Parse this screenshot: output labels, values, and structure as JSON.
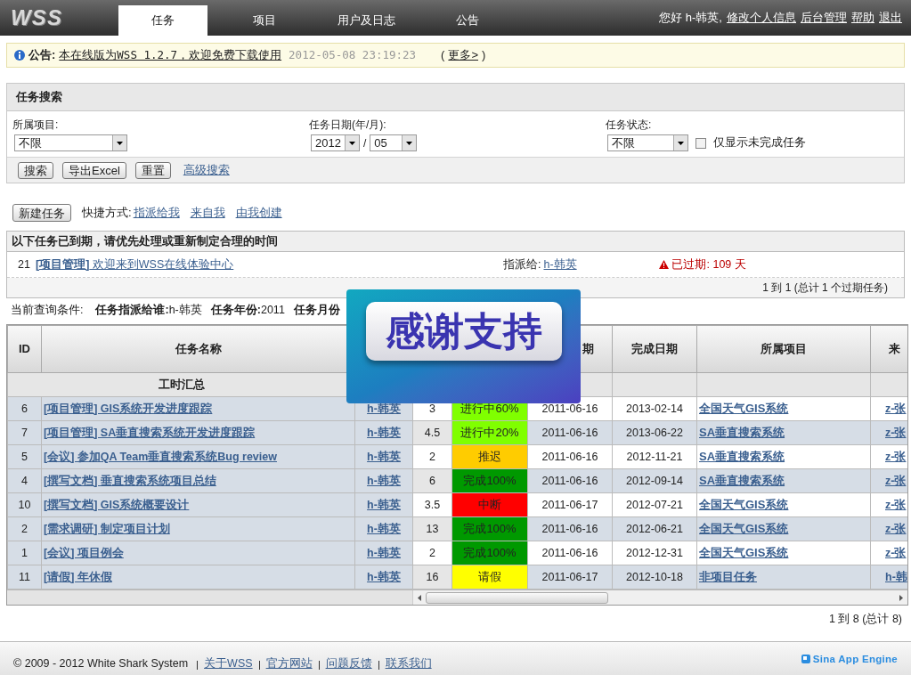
{
  "header": {
    "logo": "WSS",
    "tabs": [
      {
        "label": "任务",
        "selected": true
      },
      {
        "label": "项目",
        "selected": false
      },
      {
        "label": "用户及日志",
        "selected": false
      },
      {
        "label": "公告",
        "selected": false
      }
    ],
    "greeting": "您好 h-韩英,",
    "links": [
      "修改个人信息",
      "后台管理",
      "帮助",
      "退出"
    ]
  },
  "notice": {
    "label": "公告:",
    "text": "本在线版为WSS 1.2.7，欢迎免费下载使用",
    "time": "2012-05-08 23:19:23",
    "more_open": "(",
    "more": "更多>",
    "more_close": ")"
  },
  "search": {
    "title": "任务搜索",
    "project_label": "所属项目:",
    "project_value": "不限",
    "date_label": "任务日期(年/月):",
    "year": "2012",
    "sep": "/",
    "month": "05",
    "status_label": "任务状态:",
    "status_value": "不限",
    "only_unfinished": {
      "label": "仅显示未完成任务",
      "checked": false
    },
    "buttons": [
      "搜索",
      "导出Excel",
      "重置"
    ],
    "advanced": "高级搜索"
  },
  "actions": {
    "new_task": "新建任务",
    "shortcut_label": "快捷方式:",
    "shortcuts": [
      "指派给我",
      "来自我",
      "由我创建"
    ]
  },
  "overdue": {
    "title": "以下任务已到期，请优先处理或重新制定合理的时间",
    "rows": [
      {
        "id": "21",
        "category": "[项目管理]",
        "name": "欢迎来到WSS在线体验中心",
        "assign_label": "指派给:",
        "assignee": "h-韩英",
        "overdue": "已过期: 109 天"
      }
    ],
    "pager": "1 到 1 (总计 1 个过期任务)"
  },
  "query": {
    "label": "当前查询条件:",
    "conditions": [
      {
        "key": "任务指派给谁:",
        "value": "h-韩英"
      },
      {
        "key": "任务年份:",
        "value": "2011"
      },
      {
        "key": "任务月份"
      }
    ]
  },
  "table": {
    "columns": [
      "ID",
      "任务名称",
      "",
      "",
      "",
      "期",
      "完成日期",
      "所属项目",
      "来"
    ],
    "summary_label": "工时汇总",
    "rows": [
      {
        "id": "6",
        "name": "[项目管理] GIS系统开发进度跟踪",
        "owner": "h-韩英",
        "hours": "3",
        "status": "进行中60%",
        "color": "#80ff00",
        "start": "2011-06-16",
        "end": "2013-02-14",
        "project": "全国天气GIS系统",
        "from": "z-张"
      },
      {
        "id": "7",
        "name": "[项目管理] SA垂直搜索系统开发进度跟踪",
        "owner": "h-韩英",
        "hours": "4.5",
        "status": "进行中20%",
        "color": "#80ff00",
        "start": "2011-06-16",
        "end": "2013-06-22",
        "project": "SA垂直搜索系统",
        "from": "z-张"
      },
      {
        "id": "5",
        "name": "[会议] 参加QA Team垂直搜索系统Bug review",
        "owner": "h-韩英",
        "hours": "2",
        "status": "推迟",
        "color": "#ffcc00",
        "start": "2011-06-16",
        "end": "2012-11-21",
        "project": "SA垂直搜索系统",
        "from": "z-张"
      },
      {
        "id": "4",
        "name": "[撰写文档] 垂直搜索系统项目总结",
        "owner": "h-韩英",
        "hours": "6",
        "status": "完成100%",
        "color": "#009900",
        "start": "2011-06-16",
        "end": "2012-09-14",
        "project": "SA垂直搜索系统",
        "from": "z-张"
      },
      {
        "id": "10",
        "name": "[撰写文档] GIS系统概要设计",
        "owner": "h-韩英",
        "hours": "3.5",
        "status": "中断",
        "color": "#ff0000",
        "start": "2011-06-17",
        "end": "2012-07-21",
        "project": "全国天气GIS系统",
        "from": "z-张"
      },
      {
        "id": "2",
        "name": "[需求调研] 制定项目计划",
        "owner": "h-韩英",
        "hours": "13",
        "status": "完成100%",
        "color": "#009900",
        "start": "2011-06-16",
        "end": "2012-06-21",
        "project": "全国天气GIS系统",
        "from": "z-张"
      },
      {
        "id": "1",
        "name": "[会议] 项目例会",
        "owner": "h-韩英",
        "hours": "2",
        "status": "完成100%",
        "color": "#009900",
        "start": "2011-06-16",
        "end": "2012-12-31",
        "project": "全国天气GIS系统",
        "from": "z-张"
      },
      {
        "id": "11",
        "name": "[请假] 年休假",
        "owner": "h-韩英",
        "hours": "16",
        "status": "请假",
        "color": "#ffff00",
        "start": "2011-06-17",
        "end": "2012-10-18",
        "project": "非项目任务",
        "from": "h-韩"
      }
    ],
    "pager": "1 到 8 (总计 8)"
  },
  "overlay": {
    "text": "感谢支持"
  },
  "footer": {
    "copyright": "© 2009 - 2012 White Shark System",
    "links": [
      "关于WSS",
      "官方网站",
      "问题反馈",
      "联系我们"
    ],
    "badge": "Sina App Engine"
  }
}
